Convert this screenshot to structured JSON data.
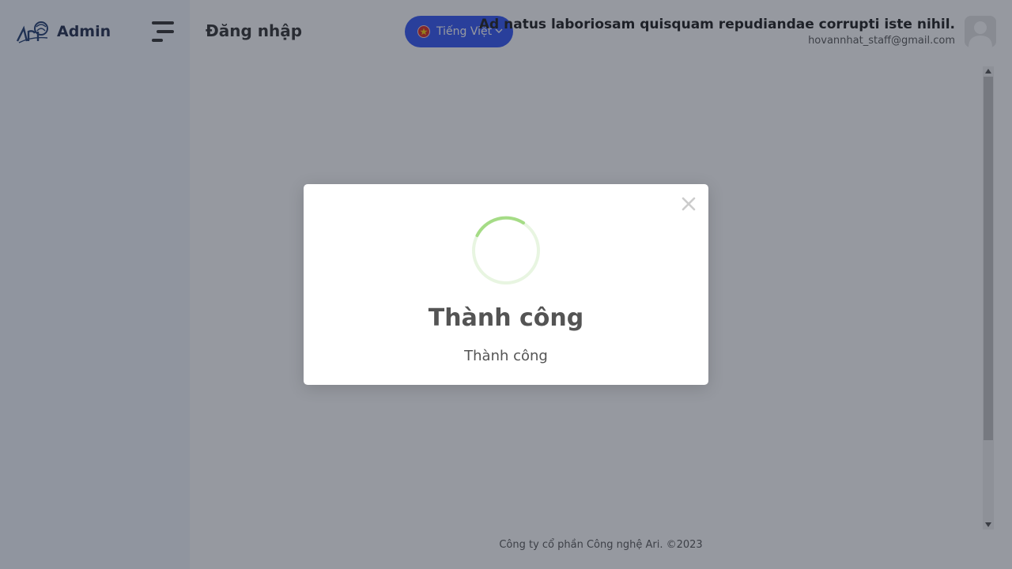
{
  "sidebar": {
    "brand_name": "Admin",
    "logo_text": "ARI"
  },
  "header": {
    "page_title": "Đăng nhập",
    "language": {
      "label": "Tiếng Việt",
      "flag": "vietnam-flag-icon"
    },
    "user": {
      "name": "Ad natus laboriosam quisquam repudiandae corrupti iste nihil.",
      "email": "hovannhat_staff@gmail.com"
    }
  },
  "footer": {
    "text": "Công ty cổ phần Công nghệ Ari. ©2023"
  },
  "modal": {
    "title": "Thành công",
    "message": "Thành công",
    "icon": "success-spinner-icon",
    "close_icon": "close-icon"
  },
  "colors": {
    "accent": "#2e54f5",
    "success": "#a5dc86",
    "sidebar_bg": "#f4f7fe",
    "overlay": "rgba(36,42,56,0.48)"
  }
}
